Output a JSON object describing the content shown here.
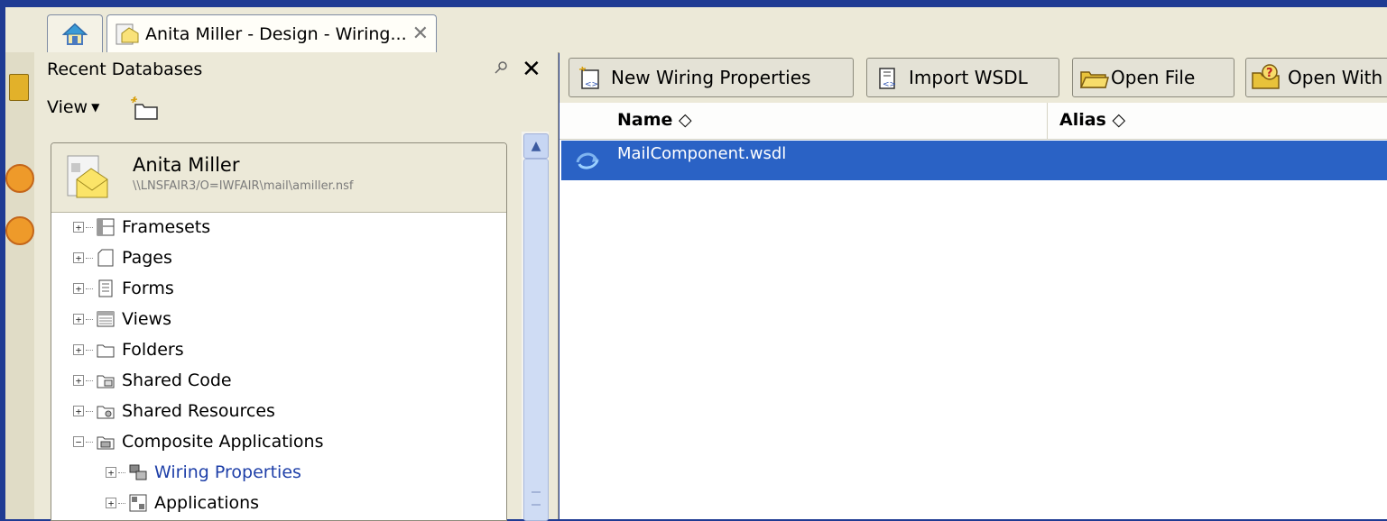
{
  "tabs": {
    "home_icon": "home-icon",
    "document_tab_label": "Anita Miller - Design - Wiring...",
    "close_glyph": "✕"
  },
  "nav_panel": {
    "title": "Recent Databases",
    "close_glyph": "✕",
    "view_label": "View",
    "view_caret": "▼",
    "database": {
      "name": "Anita Miller",
      "path": "\\\\LNSFAIR3/O=IWFAIR\\mail\\amiller.nsf"
    },
    "tree": [
      {
        "label": "Framesets",
        "expander": "+",
        "icon": "frameset-icon",
        "level": 0
      },
      {
        "label": "Pages",
        "expander": "+",
        "icon": "page-icon",
        "level": 0
      },
      {
        "label": "Forms",
        "expander": "+",
        "icon": "form-icon",
        "level": 0
      },
      {
        "label": "Views",
        "expander": "+",
        "icon": "view-icon",
        "level": 0
      },
      {
        "label": "Folders",
        "expander": "+",
        "icon": "folder-icon",
        "level": 0
      },
      {
        "label": "Shared Code",
        "expander": "+",
        "icon": "shared-code-icon",
        "level": 0
      },
      {
        "label": "Shared Resources",
        "expander": "+",
        "icon": "shared-resources-icon",
        "level": 0
      },
      {
        "label": "Composite Applications",
        "expander": "−",
        "icon": "composite-applications-icon",
        "level": 0
      },
      {
        "label": "Wiring Properties",
        "expander": "+",
        "icon": "wiring-properties-icon",
        "level": 1,
        "selected": true
      },
      {
        "label": "Applications",
        "expander": "+",
        "icon": "applications-icon",
        "level": 1
      }
    ]
  },
  "toolbar": {
    "new_wiring_properties": "New Wiring Properties",
    "import_wsdl": "Import WSDL",
    "open_file": "Open File",
    "open_with": "Open With"
  },
  "list": {
    "columns": [
      "Name",
      "Alias"
    ],
    "sort_glyph": "◇",
    "rows": [
      {
        "name": "MailComponent.wsdl",
        "alias": ""
      }
    ]
  },
  "colors": {
    "selection": "#2a62c5",
    "frame": "#1f3b93",
    "link": "#1e3fa8"
  }
}
